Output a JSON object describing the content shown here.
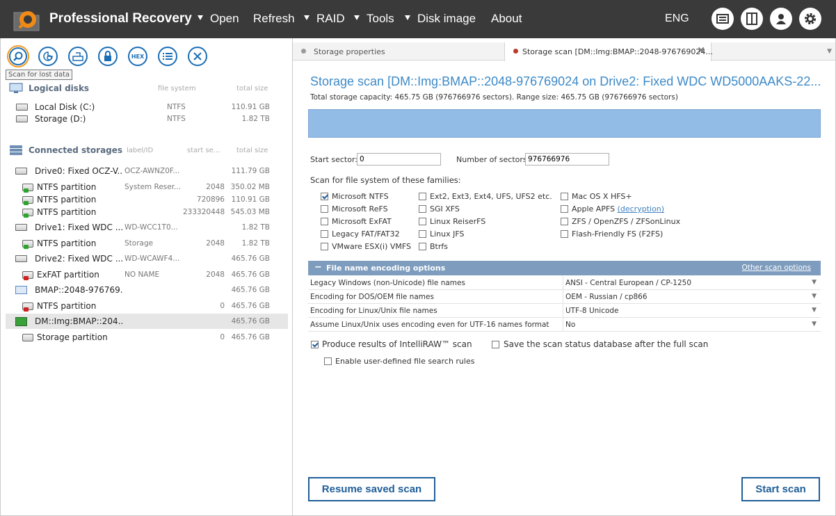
{
  "app": {
    "title": "Professional Recovery",
    "language": "ENG"
  },
  "menu": [
    {
      "label": "Open",
      "has_dropdown": true
    },
    {
      "label": "Refresh",
      "has_dropdown": false
    },
    {
      "label": "RAID",
      "has_dropdown": true
    },
    {
      "label": "Tools",
      "has_dropdown": true
    },
    {
      "label": "Disk image",
      "has_dropdown": true
    },
    {
      "label": "About",
      "has_dropdown": false
    }
  ],
  "toolbar": {
    "tooltip": "Scan for lost data",
    "hex_label": "HEX"
  },
  "logical_disks": {
    "header": "Logical disks",
    "col_fs": "file system",
    "col_size": "total size",
    "items": [
      {
        "name": "Local Disk (C:)",
        "fs": "NTFS",
        "size": "110.91 GB"
      },
      {
        "name": "Storage (D:)",
        "fs": "NTFS",
        "size": "1.82 TB"
      }
    ]
  },
  "connected_storages": {
    "header": "Connected storages",
    "col_label": "label/ID",
    "col_start": "start se...",
    "col_size": "total size",
    "items": [
      {
        "name": "Drive0: Fixed OCZ-V...",
        "label": "OCZ-AWNZ0F...",
        "start": "",
        "size": "111.79 GB",
        "kind": "drive"
      },
      {
        "name": "NTFS partition",
        "label": "System Reser...",
        "start": "2048",
        "size": "350.02 MB",
        "kind": "part-green"
      },
      {
        "name": "NTFS partition",
        "label": "",
        "start": "720896",
        "size": "110.91 GB",
        "kind": "part-green"
      },
      {
        "name": "NTFS partition",
        "label": "",
        "start": "233320448",
        "size": "545.03 MB",
        "kind": "part-green"
      },
      {
        "name": "Drive1: Fixed WDC ...",
        "label": "WD-WCC1T0...",
        "start": "",
        "size": "1.82 TB",
        "kind": "drive"
      },
      {
        "name": "NTFS partition",
        "label": "Storage",
        "start": "2048",
        "size": "1.82 TB",
        "kind": "part-green"
      },
      {
        "name": "Drive2: Fixed WDC ...",
        "label": "WD-WCAWF4...",
        "start": "",
        "size": "465.76 GB",
        "kind": "drive"
      },
      {
        "name": "ExFAT partition",
        "label": "NO NAME",
        "start": "2048",
        "size": "465.76 GB",
        "kind": "part-red"
      },
      {
        "name": "BMAP::2048-976769...",
        "label": "",
        "start": "",
        "size": "465.76 GB",
        "kind": "bmap"
      },
      {
        "name": "NTFS partition",
        "label": "",
        "start": "0",
        "size": "465.76 GB",
        "kind": "part-red"
      },
      {
        "name": "DM::Img:BMAP::204...",
        "label": "",
        "start": "",
        "size": "465.76 GB",
        "kind": "dm",
        "selected": true
      },
      {
        "name": "Storage partition",
        "label": "",
        "start": "0",
        "size": "465.76 GB",
        "kind": "part-plain"
      }
    ]
  },
  "tabs": [
    {
      "label": "Storage properties",
      "active": false,
      "dot_color": "#9a9a9a"
    },
    {
      "label": "Storage scan [DM::Img:BMAP::2048-976769024...",
      "active": true,
      "dot_color": "#c0392b"
    }
  ],
  "scan": {
    "title": "Storage scan [DM::Img:BMAP::2048-976769024 on Drive2: Fixed WDC WD5000AAKS-22...",
    "subtitle": "Total storage capacity: 465.75 GB (976766976 sectors). Range size: 465.75 GB (976766976 sectors)",
    "start_sector_label": "Start sector:",
    "start_sector_value": "0",
    "num_sectors_label": "Number of sectors:",
    "num_sectors_value": "976766976",
    "families_label": "Scan for file system of these families:",
    "fs_col1": [
      {
        "label": "Microsoft NTFS",
        "checked": true
      },
      {
        "label": "Microsoft ReFS",
        "checked": false
      },
      {
        "label": "Microsoft ExFAT",
        "checked": false
      },
      {
        "label": "Legacy FAT/FAT32",
        "checked": false
      },
      {
        "label": "VMware ESX(i) VMFS",
        "checked": false
      }
    ],
    "fs_col2": [
      {
        "label": "Ext2, Ext3, Ext4, UFS, UFS2 etc.",
        "checked": false
      },
      {
        "label": "SGI XFS",
        "checked": false
      },
      {
        "label": "Linux ReiserFS",
        "checked": false
      },
      {
        "label": "Linux JFS",
        "checked": false
      },
      {
        "label": "Btrfs",
        "checked": false
      }
    ],
    "fs_col3": [
      {
        "label": "Mac OS X HFS+",
        "checked": false
      },
      {
        "label": "Apple APFS",
        "checked": false,
        "link": "(decryption)"
      },
      {
        "label": "ZFS / OpenZFS / ZFSonLinux",
        "checked": false
      },
      {
        "label": "Flash-Friendly FS (F2FS)",
        "checked": false
      }
    ],
    "encoding": {
      "header": "File name encoding options",
      "other_link": "Other scan options",
      "rows": [
        {
          "key": "Legacy Windows (non-Unicode) file names",
          "value": "ANSI - Central European / CP-1250"
        },
        {
          "key": "Encoding for DOS/OEM file names",
          "value": "OEM - Russian / cp866"
        },
        {
          "key": "Encoding for Linux/Unix file names",
          "value": "UTF-8 Unicode"
        },
        {
          "key": "Assume Linux/Unix uses encoding even for UTF-16 names format",
          "value": "No"
        }
      ]
    },
    "options": {
      "intelliraw": {
        "label": "Produce results of IntelliRAW™ scan",
        "checked": true
      },
      "save_db": {
        "label": "Save the scan status database after the full scan",
        "checked": false
      },
      "user_rules": {
        "label": "Enable user-defined file search rules",
        "checked": false
      }
    },
    "resume_button": "Resume saved scan",
    "start_button": "Start scan"
  },
  "colors": {
    "topbar": "#3a3a3a",
    "accent": "#1f5e99",
    "title_blue": "#3d8ac8",
    "scan_bar": "#92bbe6",
    "enc_header": "#7e9cbd"
  }
}
